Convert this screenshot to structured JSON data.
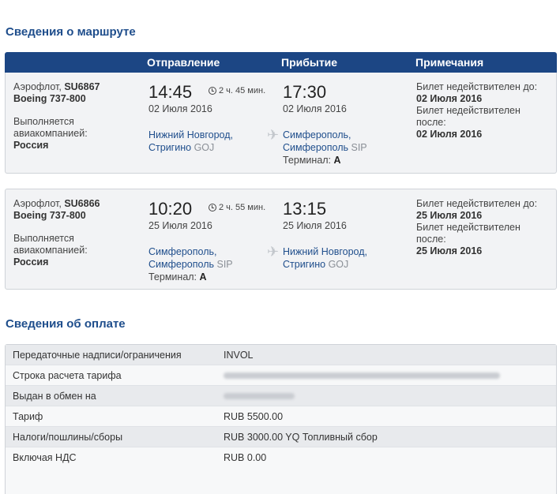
{
  "route": {
    "title": "Сведения о маршруте",
    "headers": {
      "departure": "Отправление",
      "arrival": "Прибытие",
      "notes": "Примечания"
    },
    "flights": [
      {
        "airline": "Аэрофлот,",
        "flight_no": "SU6867",
        "aircraft": "Boeing 737-800",
        "operated_by_label": "Выполняется авиакомпанией:",
        "operator": "Россия",
        "dep_time": "14:45",
        "duration": "2 ч. 45 мин.",
        "dep_date": "02 Июля 2016",
        "dep_city": "Нижний Новгород,",
        "dep_airport": "Стригино",
        "dep_code": "GOJ",
        "dep_terminal_label": "",
        "dep_terminal": "",
        "arr_time": "17:30",
        "arr_date": "02 Июля 2016",
        "arr_city": "Симферополь,",
        "arr_airport": "Симферополь",
        "arr_code": "SIP",
        "arr_terminal_label": "Терминал:",
        "arr_terminal": "A",
        "not_valid_until_label": "Билет недействителен до:",
        "not_valid_until": "02 Июля 2016",
        "not_valid_after_label": "Билет недействителен после:",
        "not_valid_after": "02 Июля 2016"
      },
      {
        "airline": "Аэрофлот,",
        "flight_no": "SU6866",
        "aircraft": "Boeing 737-800",
        "operated_by_label": "Выполняется авиакомпанией:",
        "operator": "Россия",
        "dep_time": "10:20",
        "duration": "2 ч. 55 мин.",
        "dep_date": "25 Июля 2016",
        "dep_city": "Симферополь,",
        "dep_airport": "Симферополь",
        "dep_code": "SIP",
        "dep_terminal_label": "Терминал:",
        "dep_terminal": "A",
        "arr_time": "13:15",
        "arr_date": "25 Июля 2016",
        "arr_city": "Нижний Новгород,",
        "arr_airport": "Стригино",
        "arr_code": "GOJ",
        "arr_terminal_label": "",
        "arr_terminal": "",
        "not_valid_until_label": "Билет недействителен до:",
        "not_valid_until": "25 Июля 2016",
        "not_valid_after_label": "Билет недействителен после:",
        "not_valid_after": "25 Июля 2016"
      }
    ]
  },
  "payment": {
    "title": "Сведения об оплате",
    "rows": [
      {
        "label": "Передаточные надписи/ограничения",
        "value": "INVOL"
      },
      {
        "label": "Строка расчета тарифа",
        "value": ""
      },
      {
        "label": "Выдан в обмен на",
        "value": ""
      },
      {
        "label": "Тариф",
        "value": "RUB 5500.00"
      },
      {
        "label": "Налоги/пошлины/сборы",
        "value": "RUB 3000.00 YQ Топливный сбор"
      },
      {
        "label": "Включая НДС",
        "value": "RUB 0.00"
      }
    ]
  },
  "icons": {
    "duration": "clock-icon",
    "route": "airplane-icon"
  },
  "colors": {
    "header_bg": "#1c4684",
    "title": "#1f4e8c",
    "city_link": "#1f4e8c"
  }
}
